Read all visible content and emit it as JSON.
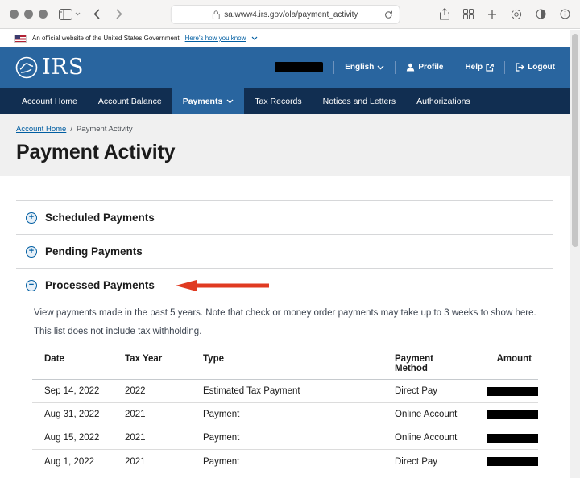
{
  "browser": {
    "url": "sa.www4.irs.gov/ola/payment_activity",
    "icons": [
      "sidebar-icon",
      "back-icon",
      "forward-icon",
      "lock-icon",
      "reload-icon",
      "share-icon",
      "tab-grid-icon",
      "new-tab-icon",
      "extensions-icon",
      "reader-icon",
      "page-info-icon"
    ]
  },
  "gov_banner": {
    "text": "An official website of the United States Government",
    "link": "Here's how you know"
  },
  "header": {
    "logo_text": "IRS",
    "user_name_redacted": true,
    "language_label": "English",
    "profile_label": "Profile",
    "help_label": "Help",
    "logout_label": "Logout"
  },
  "nav": {
    "items": [
      {
        "label": "Account Home",
        "active": false
      },
      {
        "label": "Account Balance",
        "active": false
      },
      {
        "label": "Payments",
        "active": true
      },
      {
        "label": "Tax Records",
        "active": false
      },
      {
        "label": "Notices and Letters",
        "active": false
      },
      {
        "label": "Authorizations",
        "active": false
      }
    ]
  },
  "breadcrumb": {
    "home": "Account Home",
    "separator": "/",
    "current": "Payment Activity"
  },
  "page": {
    "title": "Payment Activity"
  },
  "accordions": {
    "scheduled": {
      "label": "Scheduled Payments",
      "expanded": false
    },
    "pending": {
      "label": "Pending Payments",
      "expanded": false
    },
    "processed": {
      "label": "Processed Payments",
      "expanded": true,
      "annotation": "red-arrow-pointing-left"
    }
  },
  "icons_glyphs": {
    "expand": "+",
    "collapse": "−"
  },
  "processed": {
    "description": "View payments made in the past 5 years. Note that check or money order payments may take up to 3 weeks to show here.",
    "note": "This list does not include tax withholding.",
    "table": {
      "headers": [
        "Date",
        "Tax Year",
        "Type",
        "Payment Method",
        "Amount"
      ],
      "rows": [
        {
          "date": "Sep 14, 2022",
          "tax_year": "2022",
          "type": "Estimated Tax Payment",
          "method": "Direct Pay",
          "amount_redacted": true
        },
        {
          "date": "Aug 31, 2022",
          "tax_year": "2021",
          "type": "Payment",
          "method": "Online Account",
          "amount_redacted": true
        },
        {
          "date": "Aug 15, 2022",
          "tax_year": "2021",
          "type": "Payment",
          "method": "Online Account",
          "amount_redacted": true
        },
        {
          "date": "Aug 1, 2022",
          "tax_year": "2021",
          "type": "Payment",
          "method": "Direct Pay",
          "amount_redacted": true
        }
      ]
    }
  },
  "colors": {
    "header_blue": "#29659f",
    "nav_navy": "#112e51",
    "link_blue": "#005ea2",
    "annotation_red": "#e03a21",
    "redaction_black": "#000000",
    "band_gray": "#f0f0f0"
  }
}
